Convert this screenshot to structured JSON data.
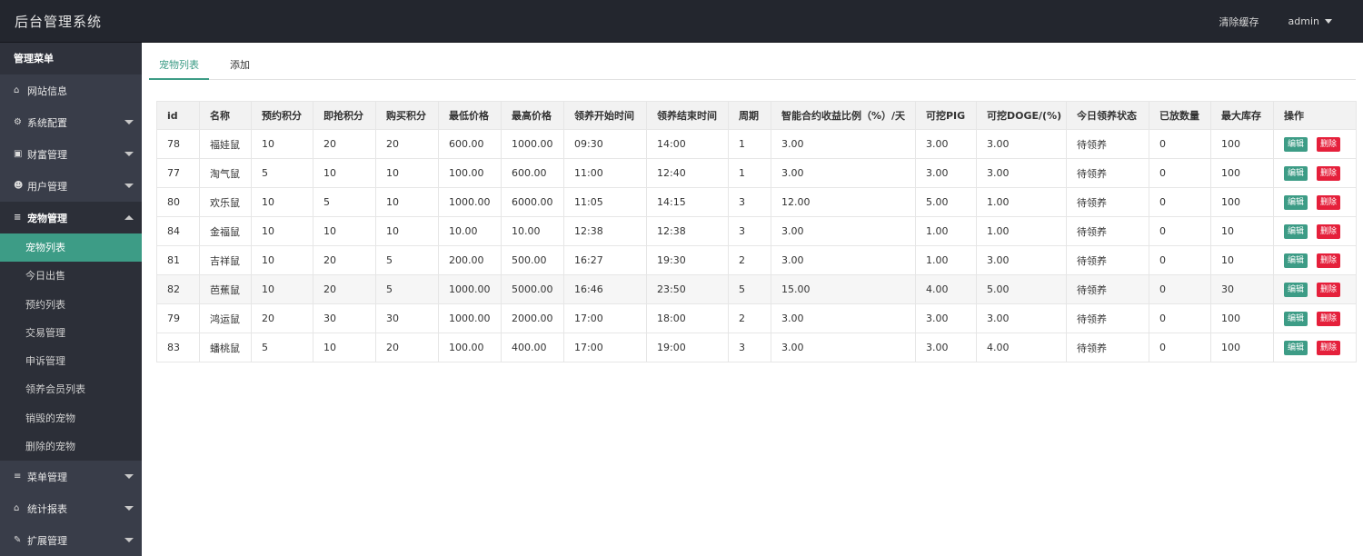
{
  "app": {
    "title": "后台管理系统"
  },
  "topbar": {
    "clear_cache": "清除缓存",
    "user": "admin"
  },
  "sidebar": {
    "header": "管理菜单",
    "items_top": [
      {
        "label": "网站信息",
        "icon": "home-icon",
        "glyph": "⌂",
        "has_arrow": false
      },
      {
        "label": "系统配置",
        "icon": "gears-icon",
        "glyph": "⚙",
        "has_arrow": true
      },
      {
        "label": "财富管理",
        "icon": "money-icon",
        "glyph": "▣",
        "has_arrow": true
      },
      {
        "label": "用户管理",
        "icon": "users-icon",
        "glyph": "☻",
        "has_arrow": true
      }
    ],
    "open_item": {
      "label": "宠物管理",
      "icon": "list-icon",
      "glyph": "≡"
    },
    "sub_items": [
      "宠物列表",
      "今日出售",
      "预约列表",
      "交易管理",
      "申诉管理",
      "领养会员列表",
      "销毁的宠物",
      "删除的宠物"
    ],
    "items_bottom": [
      {
        "label": "菜单管理",
        "icon": "list-icon",
        "glyph": "≡"
      },
      {
        "label": "统计报表",
        "icon": "home-icon",
        "glyph": "⌂"
      },
      {
        "label": "扩展管理",
        "icon": "wrench-icon",
        "glyph": "✎"
      }
    ]
  },
  "tabs": [
    "宠物列表",
    "添加"
  ],
  "table": {
    "columns": [
      "id",
      "名称",
      "预约积分",
      "即抢积分",
      "购买积分",
      "最低价格",
      "最高价格",
      "领养开始时间",
      "领养结束时间",
      "周期",
      "智能合约收益比例（%）/天",
      "可挖PIG",
      "可挖DOGE/(%)",
      "今日领养状态",
      "已放数量",
      "最大库存",
      "操作"
    ],
    "rows": [
      [
        "78",
        "福娃鼠",
        "10",
        "20",
        "20",
        "600.00",
        "1000.00",
        "09:30",
        "14:00",
        "1",
        "3.00",
        "3.00",
        "3.00",
        "待领养",
        "0",
        "100"
      ],
      [
        "77",
        "淘气鼠",
        "5",
        "10",
        "10",
        "100.00",
        "600.00",
        "11:00",
        "12:40",
        "1",
        "3.00",
        "3.00",
        "3.00",
        "待领养",
        "0",
        "100"
      ],
      [
        "80",
        "欢乐鼠",
        "10",
        "5",
        "10",
        "1000.00",
        "6000.00",
        "11:05",
        "14:15",
        "3",
        "12.00",
        "5.00",
        "1.00",
        "待领养",
        "0",
        "100"
      ],
      [
        "84",
        "金福鼠",
        "10",
        "10",
        "10",
        "10.00",
        "10.00",
        "12:38",
        "12:38",
        "3",
        "3.00",
        "1.00",
        "1.00",
        "待领养",
        "0",
        "10"
      ],
      [
        "81",
        "吉祥鼠",
        "10",
        "20",
        "5",
        "200.00",
        "500.00",
        "16:27",
        "19:30",
        "2",
        "3.00",
        "1.00",
        "3.00",
        "待领养",
        "0",
        "10"
      ],
      [
        "82",
        "芭蕉鼠",
        "10",
        "20",
        "5",
        "1000.00",
        "5000.00",
        "16:46",
        "23:50",
        "5",
        "15.00",
        "4.00",
        "5.00",
        "待领养",
        "0",
        "30"
      ],
      [
        "79",
        "鸿运鼠",
        "20",
        "30",
        "30",
        "1000.00",
        "2000.00",
        "17:00",
        "18:00",
        "2",
        "3.00",
        "3.00",
        "3.00",
        "待领养",
        "0",
        "100"
      ],
      [
        "83",
        "蟠桃鼠",
        "5",
        "10",
        "20",
        "100.00",
        "400.00",
        "17:00",
        "19:00",
        "3",
        "3.00",
        "3.00",
        "4.00",
        "待领养",
        "0",
        "100"
      ]
    ],
    "actions": {
      "edit": "编辑",
      "delete": "删除"
    }
  },
  "colors": {
    "accent": "#3d9c86",
    "danger": "#e5203b",
    "topbar": "#23262e",
    "sidebar": "#393d49"
  }
}
